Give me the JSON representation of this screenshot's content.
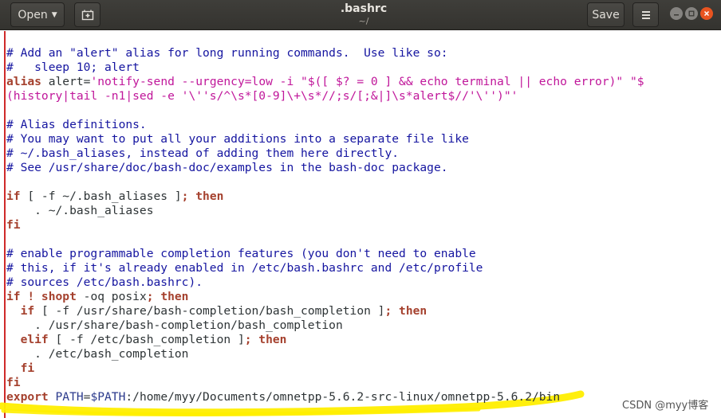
{
  "window": {
    "title": ".bashrc",
    "subtitle": "~/"
  },
  "toolbar": {
    "open_label": "Open",
    "save_label": "Save"
  },
  "colors": {
    "comment": "#1515a0",
    "keyword": "#a5412e",
    "string": "#c0169a",
    "path": "#2b3a8c",
    "margin": "#cf2a2a",
    "highlight": "#ffee00"
  },
  "icons": {
    "new_document": "new-document-icon",
    "menu": "hamburger-menu-icon",
    "minimize": "minimize-icon",
    "maximize": "maximize-icon",
    "close": "close-icon"
  },
  "editor": {
    "lines": [
      [
        {
          "k": "c",
          "t": "# Add an \"alert\" alias for long running commands.  Use like so:"
        }
      ],
      [
        {
          "k": "c",
          "t": "#   sleep 10; alert"
        }
      ],
      [
        {
          "k": "k",
          "t": "alias"
        },
        {
          "k": "t",
          "t": " alert="
        },
        {
          "k": "s",
          "t": "'notify-send --urgency=low -i \"$([ $? = 0 ] && echo terminal || echo error)\" \"$"
        }
      ],
      [
        {
          "k": "s",
          "t": "(history|tail -n1|sed -e '\\''s/^\\s*[0-9]\\+\\s*//;s/[;&|]\\s*alert$//'\\'')\"'"
        }
      ],
      [
        {
          "k": "t",
          "t": ""
        }
      ],
      [
        {
          "k": "c",
          "t": "# Alias definitions."
        }
      ],
      [
        {
          "k": "c",
          "t": "# You may want to put all your additions into a separate file like"
        }
      ],
      [
        {
          "k": "c",
          "t": "# ~/.bash_aliases, instead of adding them here directly."
        }
      ],
      [
        {
          "k": "c",
          "t": "# See /usr/share/doc/bash-doc/examples in the bash-doc package."
        }
      ],
      [
        {
          "k": "t",
          "t": ""
        }
      ],
      [
        {
          "k": "k",
          "t": "if"
        },
        {
          "k": "t",
          "t": " [ -f ~/.bash_aliases ]"
        },
        {
          "k": "k",
          "t": "; then"
        }
      ],
      [
        {
          "k": "t",
          "t": "    . ~/.bash_aliases"
        }
      ],
      [
        {
          "k": "k",
          "t": "fi"
        }
      ],
      [
        {
          "k": "t",
          "t": ""
        }
      ],
      [
        {
          "k": "c",
          "t": "# enable programmable completion features (you don't need to enable"
        }
      ],
      [
        {
          "k": "c",
          "t": "# this, if it's already enabled in /etc/bash.bashrc and /etc/profile"
        }
      ],
      [
        {
          "k": "c",
          "t": "# sources /etc/bash.bashrc)."
        }
      ],
      [
        {
          "k": "k",
          "t": "if ! shopt"
        },
        {
          "k": "t",
          "t": " -oq posix"
        },
        {
          "k": "k",
          "t": "; then"
        }
      ],
      [
        {
          "k": "k",
          "t": "  if"
        },
        {
          "k": "t",
          "t": " [ -f /usr/share/bash-completion/bash_completion ]"
        },
        {
          "k": "k",
          "t": "; then"
        }
      ],
      [
        {
          "k": "t",
          "t": "    . /usr/share/bash-completion/bash_completion"
        }
      ],
      [
        {
          "k": "k",
          "t": "  elif"
        },
        {
          "k": "t",
          "t": " [ -f /etc/bash_completion ]"
        },
        {
          "k": "k",
          "t": "; then"
        }
      ],
      [
        {
          "k": "t",
          "t": "    . /etc/bash_completion"
        }
      ],
      [
        {
          "k": "k",
          "t": "  fi"
        }
      ],
      [
        {
          "k": "k",
          "t": "fi"
        }
      ],
      [
        {
          "k": "k",
          "t": "export"
        },
        {
          "k": "p",
          "t": " PATH"
        },
        {
          "k": "t",
          "t": "="
        },
        {
          "k": "p",
          "t": "$PATH"
        },
        {
          "k": "t",
          "t": ":/home/myy/Documents/omnetpp-5.6.2-src-linux/omnetpp-5.6.2/bin"
        }
      ]
    ]
  },
  "watermark": "CSDN @myy博客"
}
